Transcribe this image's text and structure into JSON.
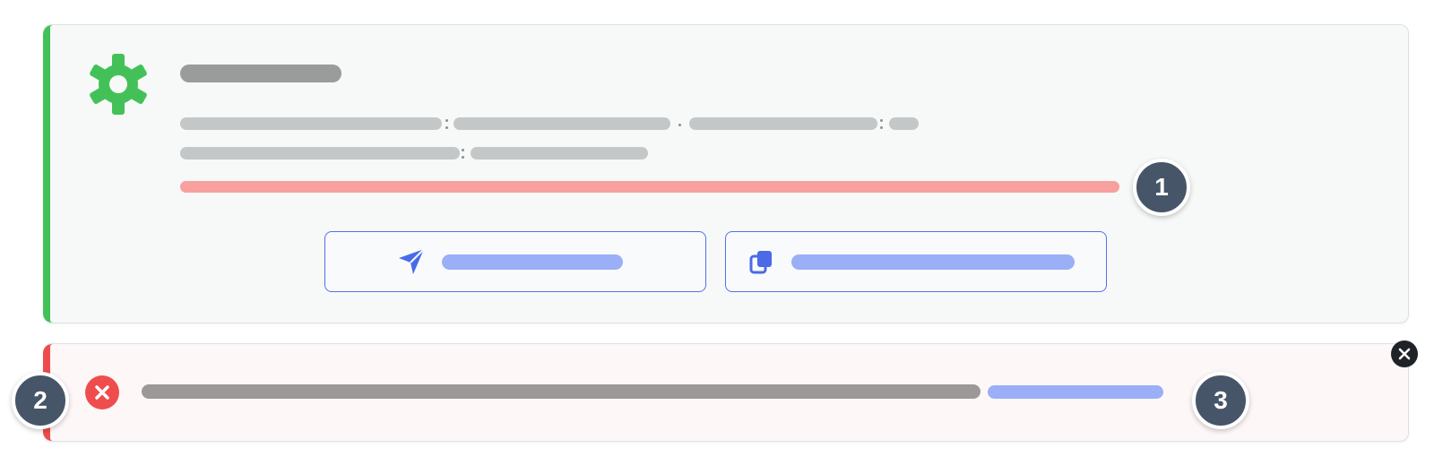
{
  "markers": {
    "m1": "1",
    "m2": "2",
    "m3": "3"
  },
  "icons": {
    "success_icon": "gear-icon",
    "send_icon": "send-icon",
    "copy_icon": "copy-icon",
    "error_icon": "error-x-icon",
    "close_icon": "close-icon"
  },
  "colors": {
    "success_accent": "#43c158",
    "error_accent": "#ee4c4c",
    "button_border": "#5470e6",
    "link": "#9aaff6",
    "marker": "#475569"
  }
}
